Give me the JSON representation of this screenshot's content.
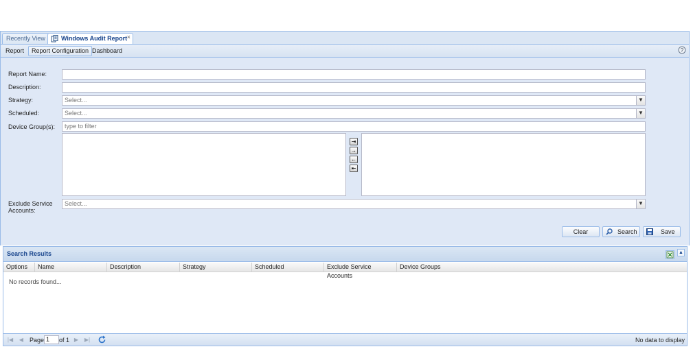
{
  "tabs": [
    {
      "label": "Recently View"
    },
    {
      "label": "Windows Audit Report",
      "close": "×"
    }
  ],
  "subnav": {
    "items": [
      {
        "label": "Report"
      },
      {
        "label": "Report Configuration"
      },
      {
        "label": "Dashboard"
      }
    ],
    "help_icon": "help-circle-icon"
  },
  "form": {
    "report_name": {
      "label": "Report Name:",
      "value": ""
    },
    "description": {
      "label": "Description:",
      "value": ""
    },
    "strategy": {
      "label": "Strategy:",
      "placeholder": "Select..."
    },
    "scheduled": {
      "label": "Scheduled:",
      "placeholder": "Select..."
    },
    "device_groups": {
      "label": "Device Group(s):",
      "placeholder": "type to filter"
    },
    "exclude_service_accounts": {
      "label": "Exclude Service Accounts:",
      "placeholder": "Select..."
    },
    "move_buttons": [
      "⇥",
      "→",
      "←",
      "⇤"
    ]
  },
  "actions": {
    "clear": "Clear",
    "search": "Search",
    "save": "Save"
  },
  "results": {
    "title": "Search Results",
    "columns": [
      "Options",
      "Name",
      "Description",
      "Strategy",
      "Scheduled",
      "Exclude Service Accounts",
      "Device Groups"
    ],
    "empty_text": "No records found...",
    "pager": {
      "page_label": "Page",
      "page_value": "1",
      "of_label": "of 1",
      "status": "No data to display"
    }
  },
  "colors": {
    "panel_bg": "#dfe8f6",
    "border": "#99bbe8",
    "title_text": "#15428b"
  }
}
